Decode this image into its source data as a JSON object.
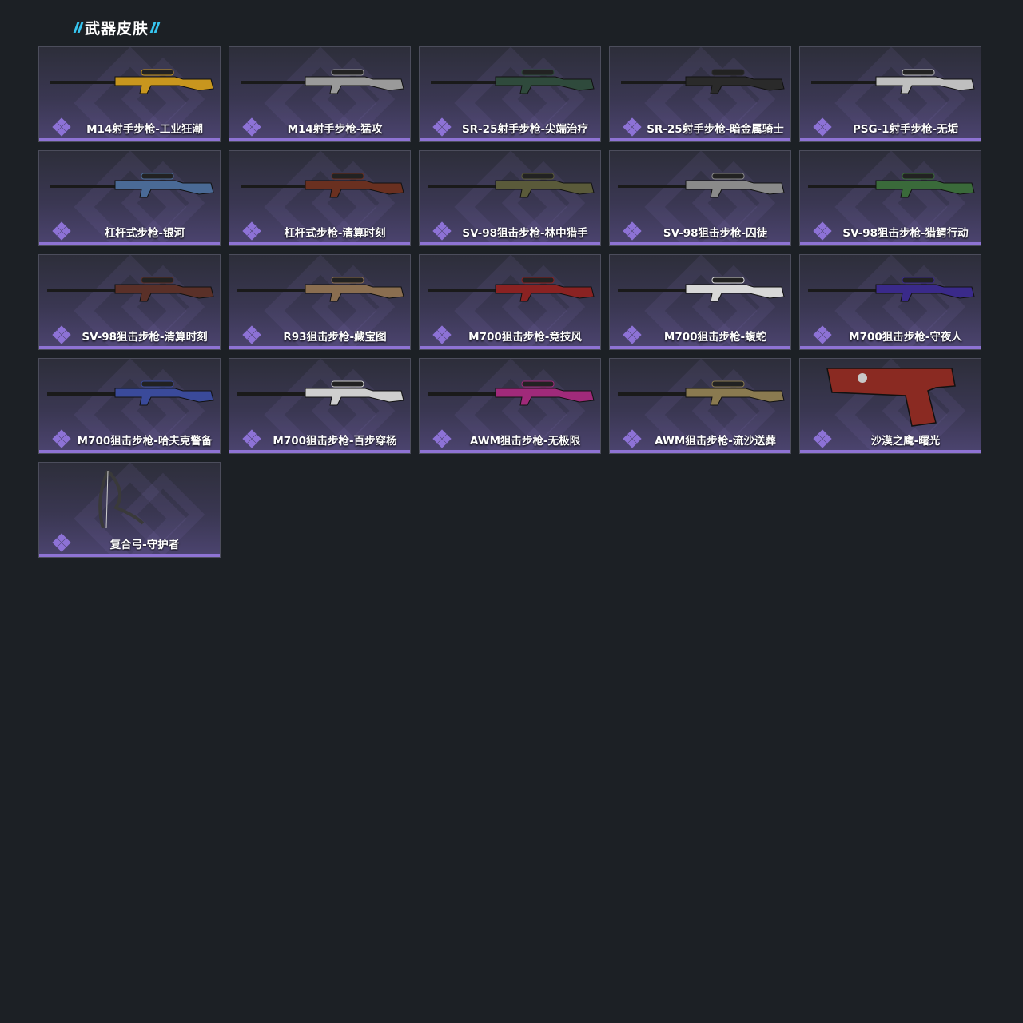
{
  "section": {
    "title": "武器皮肤"
  },
  "colors": {
    "accent": "#36c5f0",
    "rarity": "#8e73d4",
    "background": "#1c2025"
  },
  "skins": [
    {
      "label": "M14射手步枪-工业狂潮",
      "icon": "rifle-icon",
      "color": "#c8961e"
    },
    {
      "label": "M14射手步枪-猛攻",
      "icon": "rifle-icon",
      "color": "#9a9a9a"
    },
    {
      "label": "SR-25射手步枪-尖端治疗",
      "icon": "rifle-icon",
      "color": "#2f4a3c"
    },
    {
      "label": "SR-25射手步枪-暗金属骑士",
      "icon": "rifle-icon",
      "color": "#2a2a2a"
    },
    {
      "label": "PSG-1射手步枪-无垢",
      "icon": "rifle-icon",
      "color": "#bfbfbf"
    },
    {
      "label": "杠杆式步枪-银河",
      "icon": "rifle-icon",
      "color": "#4a6a96"
    },
    {
      "label": "杠杆式步枪-清算时刻",
      "icon": "rifle-icon",
      "color": "#6a3020"
    },
    {
      "label": "SV-98狙击步枪-林中猎手",
      "icon": "sniper-rifle-icon",
      "color": "#5a5a3a"
    },
    {
      "label": "SV-98狙击步枪-囚徒",
      "icon": "sniper-rifle-icon",
      "color": "#8a8a8a"
    },
    {
      "label": "SV-98狙击步枪-猎鳄行动",
      "icon": "sniper-rifle-icon",
      "color": "#3a6a3a"
    },
    {
      "label": "SV-98狙击步枪-清算时刻",
      "icon": "sniper-rifle-icon",
      "color": "#5a3028"
    },
    {
      "label": "R93狙击步枪-藏宝图",
      "icon": "sniper-rifle-icon",
      "color": "#8a6e50"
    },
    {
      "label": "M700狙击步枪-竞技风",
      "icon": "sniper-rifle-icon",
      "color": "#8a2222"
    },
    {
      "label": "M700狙击步枪-蝮蛇",
      "icon": "sniper-rifle-icon",
      "color": "#d8d8d8"
    },
    {
      "label": "M700狙击步枪-守夜人",
      "icon": "sniper-rifle-icon",
      "color": "#3a2a8a"
    },
    {
      "label": "M700狙击步枪-哈夫克警备",
      "icon": "sniper-rifle-icon",
      "color": "#3a4a9a"
    },
    {
      "label": "M700狙击步枪-百步穿杨",
      "icon": "sniper-rifle-icon",
      "color": "#cfcfcf"
    },
    {
      "label": "AWM狙击步枪-无极限",
      "icon": "sniper-rifle-icon",
      "color": "#a02a7a"
    },
    {
      "label": "AWM狙击步枪-流沙送葬",
      "icon": "sniper-rifle-icon",
      "color": "#8a7a50"
    },
    {
      "label": "沙漠之鹰-曙光",
      "icon": "pistol-icon",
      "color": "#8a2a22"
    },
    {
      "label": "复合弓-守护者",
      "icon": "bow-icon",
      "color": "#3a3a3a"
    }
  ]
}
